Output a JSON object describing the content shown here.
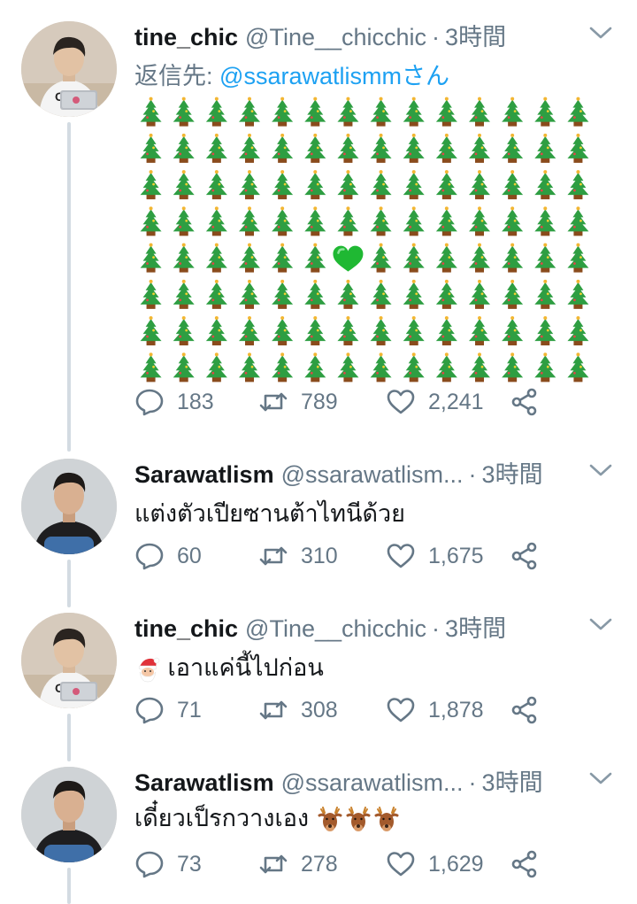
{
  "tweets": [
    {
      "name": "tine_chic",
      "handle": "@Tine__chicchic",
      "dot": "·",
      "time": "3時間",
      "reply_prefix": "返信先:",
      "reply_mention": "@ssarawatlismmさん",
      "body_emoji_grid": {
        "rows": 8,
        "cols": 14,
        "tree": "christmas-tree",
        "heart_position": "row 5, col 7"
      },
      "replies": "183",
      "retweets": "789",
      "likes": "2,241"
    },
    {
      "name": "Sarawatlism",
      "handle": "@ssarawatlism...",
      "dot": "·",
      "time": "3時間",
      "text": "แต่งตัวเปียซานต้าไทนีด้วย",
      "replies": "60",
      "retweets": "310",
      "likes": "1,675"
    },
    {
      "name": "tine_chic",
      "handle": "@Tine__chicchic",
      "dot": "·",
      "time": "3時間",
      "text_emoji": "santa-emoji",
      "text": "เอาแค่นี้ไปก่อน",
      "replies": "71",
      "retweets": "308",
      "likes": "1,878"
    },
    {
      "name": "Sarawatlism",
      "handle": "@ssarawatlism...",
      "dot": "·",
      "time": "3時間",
      "text": "เดี๋ยวเป็รกวางเอง",
      "text_emoji_suffix": [
        "deer-emoji",
        "deer-emoji",
        "deer-emoji"
      ],
      "replies": "73",
      "retweets": "278",
      "likes": "1,629"
    }
  ],
  "colors": {
    "text": "#14171a",
    "secondary": "#657786",
    "link": "#1da1f2",
    "thread_line": "#d3dbe2",
    "heart_green": "#1fb833",
    "tree_green": "#2e9e42"
  }
}
